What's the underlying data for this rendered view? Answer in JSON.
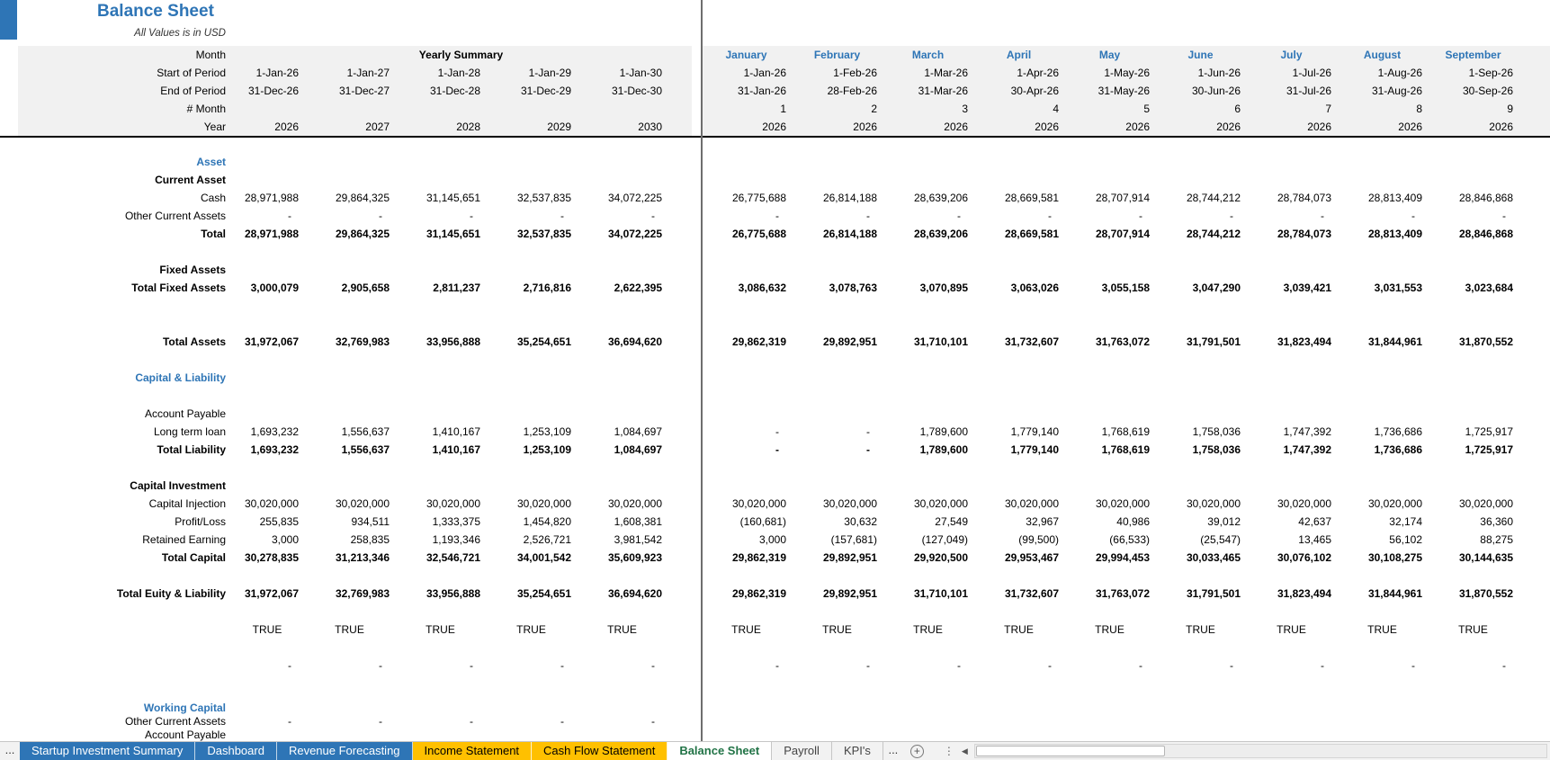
{
  "title": "Balance Sheet",
  "subtitle": "All Values is in USD",
  "colors": {
    "accent": "#2E75B6",
    "tab_blue": "#2E75B6",
    "tab_yellow": "#FFC000",
    "active_tab_text": "#217346",
    "header_bg": "#F1F1F1"
  },
  "header": {
    "row_labels": [
      "Month",
      "Start of Period",
      "End of Period",
      "# Month",
      "Year"
    ],
    "yearly_summary_label": "Yearly Summary",
    "yearly": {
      "start": [
        "1-Jan-26",
        "1-Jan-27",
        "1-Jan-28",
        "1-Jan-29",
        "1-Jan-30"
      ],
      "end": [
        "31-Dec-26",
        "31-Dec-27",
        "31-Dec-28",
        "31-Dec-29",
        "31-Dec-30"
      ],
      "num": [
        "",
        "",
        "",
        "",
        ""
      ],
      "year": [
        "2026",
        "2027",
        "2028",
        "2029",
        "2030"
      ]
    },
    "monthly": {
      "months": [
        "January",
        "February",
        "March",
        "April",
        "May",
        "June",
        "July",
        "August",
        "September"
      ],
      "start": [
        "1-Jan-26",
        "1-Feb-26",
        "1-Mar-26",
        "1-Apr-26",
        "1-May-26",
        "1-Jun-26",
        "1-Jul-26",
        "1-Aug-26",
        "1-Sep-26"
      ],
      "end": [
        "31-Jan-26",
        "28-Feb-26",
        "31-Mar-26",
        "30-Apr-26",
        "31-May-26",
        "30-Jun-26",
        "31-Jul-26",
        "31-Aug-26",
        "30-Sep-26"
      ],
      "num": [
        "1",
        "2",
        "3",
        "4",
        "5",
        "6",
        "7",
        "8",
        "9"
      ],
      "year": [
        "2026",
        "2026",
        "2026",
        "2026",
        "2026",
        "2026",
        "2026",
        "2026",
        "2026"
      ]
    }
  },
  "rows": [
    {
      "type": "section",
      "label": "Asset"
    },
    {
      "type": "boldlabel",
      "label": "Current Asset"
    },
    {
      "type": "data",
      "label": "Cash",
      "yearly": [
        "28,971,988",
        "29,864,325",
        "31,145,651",
        "32,537,835",
        "34,072,225"
      ],
      "monthly": [
        "26,775,688",
        "26,814,188",
        "28,639,206",
        "28,669,581",
        "28,707,914",
        "28,744,212",
        "28,784,073",
        "28,813,409",
        "28,846,868"
      ]
    },
    {
      "type": "data",
      "label": "Other Current Assets",
      "yearly": [
        "-",
        "-",
        "-",
        "-",
        "-"
      ],
      "monthly": [
        "-",
        "-",
        "-",
        "-",
        "-",
        "-",
        "-",
        "-",
        "-"
      ]
    },
    {
      "type": "total",
      "label": "Total",
      "yearly": [
        "28,971,988",
        "29,864,325",
        "31,145,651",
        "32,537,835",
        "34,072,225"
      ],
      "monthly": [
        "26,775,688",
        "26,814,188",
        "28,639,206",
        "28,669,581",
        "28,707,914",
        "28,744,212",
        "28,784,073",
        "28,813,409",
        "28,846,868"
      ]
    },
    {
      "type": "spacer"
    },
    {
      "type": "boldlabel",
      "label": "Fixed Assets"
    },
    {
      "type": "total",
      "label": "Total Fixed Assets",
      "yearly": [
        "3,000,079",
        "2,905,658",
        "2,811,237",
        "2,716,816",
        "2,622,395"
      ],
      "monthly": [
        "3,086,632",
        "3,078,763",
        "3,070,895",
        "3,063,026",
        "3,055,158",
        "3,047,290",
        "3,039,421",
        "3,031,553",
        "3,023,684"
      ]
    },
    {
      "type": "spacer"
    },
    {
      "type": "spacer"
    },
    {
      "type": "total",
      "label": "Total Assets",
      "yearly": [
        "31,972,067",
        "32,769,983",
        "33,956,888",
        "35,254,651",
        "36,694,620"
      ],
      "monthly": [
        "29,862,319",
        "29,892,951",
        "31,710,101",
        "31,732,607",
        "31,763,072",
        "31,791,501",
        "31,823,494",
        "31,844,961",
        "31,870,552"
      ]
    },
    {
      "type": "spacer"
    },
    {
      "type": "section",
      "label": "Capital & Liability"
    },
    {
      "type": "spacer"
    },
    {
      "type": "data",
      "label": "Account Payable"
    },
    {
      "type": "data",
      "label": "Long term loan",
      "yearly": [
        "1,693,232",
        "1,556,637",
        "1,410,167",
        "1,253,109",
        "1,084,697"
      ],
      "monthly": [
        "-",
        "-",
        "1,789,600",
        "1,779,140",
        "1,768,619",
        "1,758,036",
        "1,747,392",
        "1,736,686",
        "1,725,917"
      ]
    },
    {
      "type": "total",
      "label": "Total Liability",
      "yearly": [
        "1,693,232",
        "1,556,637",
        "1,410,167",
        "1,253,109",
        "1,084,697"
      ],
      "monthly": [
        "-",
        "-",
        "1,789,600",
        "1,779,140",
        "1,768,619",
        "1,758,036",
        "1,747,392",
        "1,736,686",
        "1,725,917"
      ]
    },
    {
      "type": "spacer"
    },
    {
      "type": "boldlabel",
      "label": "Capital Investment"
    },
    {
      "type": "data",
      "label": "Capital Injection",
      "yearly": [
        "30,020,000",
        "30,020,000",
        "30,020,000",
        "30,020,000",
        "30,020,000"
      ],
      "monthly": [
        "30,020,000",
        "30,020,000",
        "30,020,000",
        "30,020,000",
        "30,020,000",
        "30,020,000",
        "30,020,000",
        "30,020,000",
        "30,020,000"
      ]
    },
    {
      "type": "data",
      "label": "Profit/Loss",
      "yearly": [
        "255,835",
        "934,511",
        "1,333,375",
        "1,454,820",
        "1,608,381"
      ],
      "monthly": [
        "(160,681)",
        "30,632",
        "27,549",
        "32,967",
        "40,986",
        "39,012",
        "42,637",
        "32,174",
        "36,360"
      ]
    },
    {
      "type": "data",
      "label": "Retained Earning",
      "yearly": [
        "3,000",
        "258,835",
        "1,193,346",
        "2,526,721",
        "3,981,542"
      ],
      "monthly": [
        "3,000",
        "(157,681)",
        "(127,049)",
        "(99,500)",
        "(66,533)",
        "(25,547)",
        "13,465",
        "56,102",
        "88,275"
      ]
    },
    {
      "type": "total",
      "label": "Total Capital",
      "yearly": [
        "30,278,835",
        "31,213,346",
        "32,546,721",
        "34,001,542",
        "35,609,923"
      ],
      "monthly": [
        "29,862,319",
        "29,892,951",
        "29,920,500",
        "29,953,467",
        "29,994,453",
        "30,033,465",
        "30,076,102",
        "30,108,275",
        "30,144,635"
      ]
    },
    {
      "type": "spacer"
    },
    {
      "type": "total",
      "label": "Total Euity & Liability",
      "yearly": [
        "31,972,067",
        "32,769,983",
        "33,956,888",
        "35,254,651",
        "36,694,620"
      ],
      "monthly": [
        "29,862,319",
        "29,892,951",
        "31,710,101",
        "31,732,607",
        "31,763,072",
        "31,791,501",
        "31,823,494",
        "31,844,961",
        "31,870,552"
      ]
    },
    {
      "type": "spacer"
    },
    {
      "type": "true",
      "label": "",
      "yearly": [
        "TRUE",
        "TRUE",
        "TRUE",
        "TRUE",
        "TRUE"
      ],
      "monthly": [
        "TRUE",
        "TRUE",
        "TRUE",
        "TRUE",
        "TRUE",
        "TRUE",
        "TRUE",
        "TRUE",
        "TRUE"
      ]
    },
    {
      "type": "spacer"
    },
    {
      "type": "data",
      "label": "",
      "yearly": [
        "-",
        "-",
        "-",
        "-",
        "-"
      ],
      "monthly": [
        "-",
        "-",
        "-",
        "-",
        "-",
        "-",
        "-",
        "-",
        "-"
      ]
    },
    {
      "type": "spacer short"
    },
    {
      "type": "spacer short"
    },
    {
      "type": "section short",
      "label": "Working Capital"
    },
    {
      "type": "data short",
      "label": "Other Current Assets",
      "yearly": [
        "-",
        "-",
        "-",
        "-",
        "-"
      ],
      "monthly": [
        "",
        "",
        "",
        "",
        "",
        "",
        "",
        "",
        ""
      ]
    },
    {
      "type": "data short",
      "label": "Account Payable"
    }
  ],
  "tabbar": {
    "left_overflow": "...",
    "right_overflow": "...",
    "add_sheet_glyph": "+",
    "menu_glyph": "⋮",
    "scroll_left_glyph": "◀",
    "tabs": [
      {
        "label": "Startup Investment Summary",
        "style": "blue"
      },
      {
        "label": "Dashboard",
        "style": "blue"
      },
      {
        "label": "Revenue Forecasting",
        "style": "blue"
      },
      {
        "label": "Income Statement",
        "style": "yellow"
      },
      {
        "label": "Cash Flow Statement",
        "style": "yellow"
      },
      {
        "label": "Balance Sheet",
        "style": "active"
      },
      {
        "label": "Payroll",
        "style": "plain"
      },
      {
        "label": "KPI's",
        "style": "plain"
      }
    ]
  }
}
